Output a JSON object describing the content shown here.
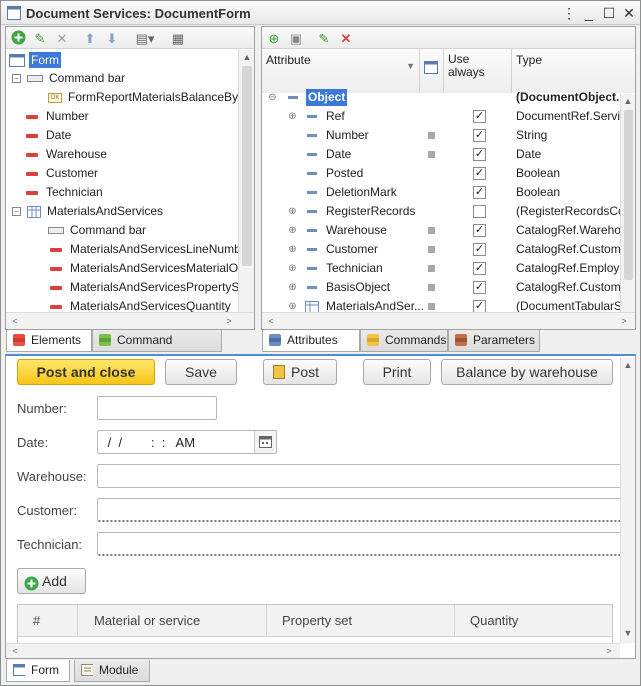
{
  "window": {
    "title": "Document Services: DocumentForm"
  },
  "left_tree": {
    "root": "Form",
    "items": [
      {
        "label": "Command bar"
      },
      {
        "label": "FormReportMaterialsBalanceByWar"
      },
      {
        "label": "Number"
      },
      {
        "label": "Date"
      },
      {
        "label": "Warehouse"
      },
      {
        "label": "Customer"
      },
      {
        "label": "Technician"
      },
      {
        "label": "MaterialsAndServices"
      },
      {
        "label": "Command bar"
      },
      {
        "label": "MaterialsAndServicesLineNumber"
      },
      {
        "label": "MaterialsAndServicesMaterialOrSer"
      },
      {
        "label": "MaterialsAndServicesPropertySet"
      },
      {
        "label": "MaterialsAndServicesQuantity"
      }
    ],
    "tabs": [
      "Elements",
      "Command interface"
    ]
  },
  "attributes": {
    "headers": {
      "attribute": "Attribute",
      "use_always": "Use always",
      "type": "Type"
    },
    "rows": [
      {
        "name": "Object",
        "type": "(DocumentObject."
      },
      {
        "name": "Ref",
        "type": "DocumentRef.Service"
      },
      {
        "name": "Number",
        "type": "String"
      },
      {
        "name": "Date",
        "type": "Date"
      },
      {
        "name": "Posted",
        "type": "Boolean"
      },
      {
        "name": "DeletionMark",
        "type": "Boolean"
      },
      {
        "name": "RegisterRecords",
        "type": "(RegisterRecordsColle"
      },
      {
        "name": "Warehouse",
        "type": "CatalogRef.Warehous"
      },
      {
        "name": "Customer",
        "type": "CatalogRef.Customers"
      },
      {
        "name": "Technician",
        "type": "CatalogRef.Employees"
      },
      {
        "name": "BasisObject",
        "type": "CatalogRef.Customers"
      },
      {
        "name": "MaterialsAndSer...",
        "type": "(DocumentTabularSec"
      }
    ],
    "tabs": [
      "Attributes",
      "Commands",
      "Parameters"
    ]
  },
  "form": {
    "buttons": {
      "post_close": "Post and close",
      "save": "Save",
      "post": "Post",
      "print": "Print",
      "balance": "Balance by warehouse"
    },
    "labels": {
      "number": "Number:",
      "date": "Date:",
      "warehouse": "Warehouse:",
      "customer": "Customer:",
      "technician": "Technician:"
    },
    "date_value": " /  /        :  :   AM",
    "add_label": "Add",
    "table_headers": [
      "#",
      "Material or service",
      "Property set",
      "Quantity"
    ]
  },
  "bottom_tabs": [
    "Form",
    "Module"
  ]
}
